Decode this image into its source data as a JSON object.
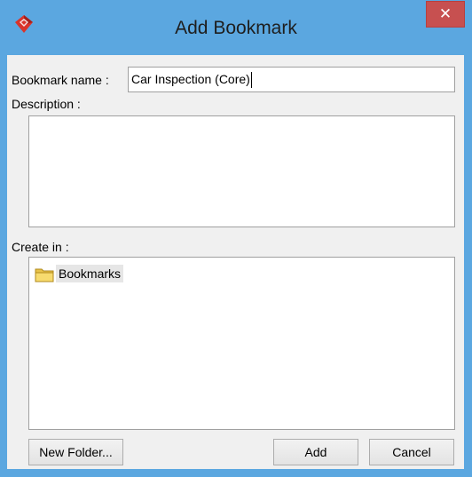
{
  "window": {
    "title": "Add Bookmark",
    "close_glyph": "✕",
    "app_icon": "visual-paradigm-logo-icon"
  },
  "form": {
    "name_label": "Bookmark name :",
    "name_value": "Car Inspection (Core)",
    "description_label": "Description :",
    "description_value": "",
    "create_in_label": "Create in :"
  },
  "tree": {
    "items": [
      {
        "label": "Bookmarks",
        "icon": "folder-icon",
        "selected": true
      }
    ]
  },
  "buttons": {
    "new_folder": "New Folder...",
    "add": "Add",
    "cancel": "Cancel"
  },
  "colors": {
    "titlebar": "#5ba7e0",
    "close": "#c75050",
    "dialog_bg": "#f0f0f0"
  }
}
